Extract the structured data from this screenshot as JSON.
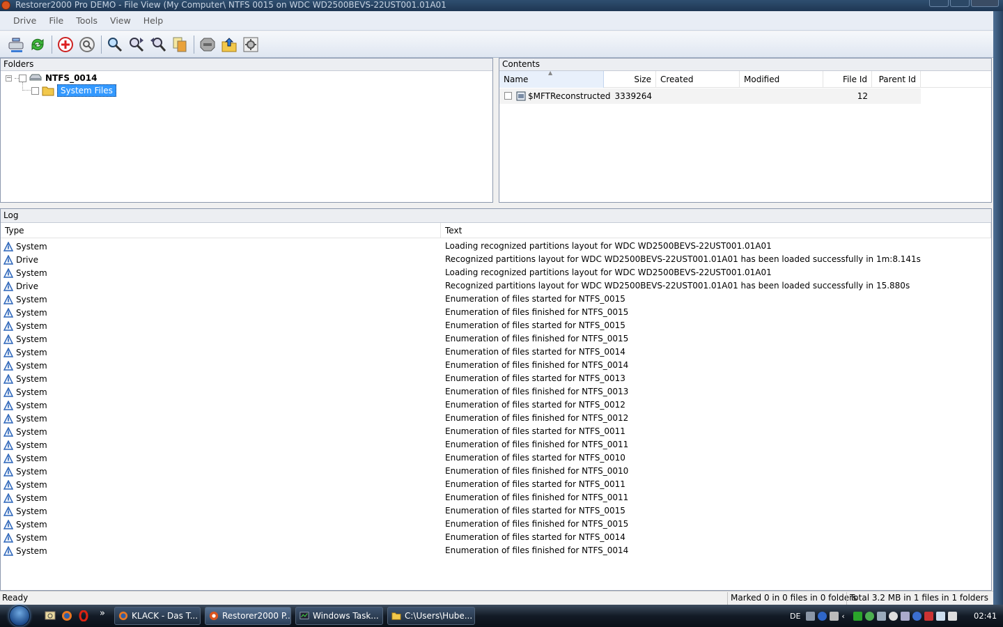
{
  "window": {
    "title": "Restorer2000 Pro DEMO - File View (My Computer\\ NTFS 0015 on WDC WD2500BEVS-22UST001.01A01"
  },
  "menu": [
    "Drive",
    "File",
    "Tools",
    "View",
    "Help"
  ],
  "toolbar": {
    "icons": [
      "connect-drive-icon",
      "refresh-icon",
      "add-region-icon",
      "scan-icon",
      "find-icon",
      "find-next-icon",
      "find-previous-icon",
      "copy-icon",
      "mark-icon",
      "recover-icon",
      "options-icon"
    ]
  },
  "folders": {
    "title": "Folders",
    "root": "NTFS_0014",
    "child": "System Files"
  },
  "contents": {
    "title": "Contents",
    "columns": {
      "name": "Name",
      "size": "Size",
      "created": "Created",
      "modified": "Modified",
      "file_id": "File Id",
      "parent_id": "Parent Id"
    },
    "rows": [
      {
        "name": "$MFTReconstructed",
        "size": "3339264",
        "created": "",
        "modified": "",
        "file_id": "12",
        "parent_id": ""
      }
    ]
  },
  "log": {
    "title": "Log",
    "columns": {
      "type": "Type",
      "text": "Text"
    },
    "rows": [
      {
        "type": "System",
        "text": "Loading recognized partitions layout for WDC WD2500BEVS-22UST001.01A01"
      },
      {
        "type": "Drive",
        "text": "Recognized partitions layout for WDC WD2500BEVS-22UST001.01A01 has been loaded successfully in 1m:8.141s"
      },
      {
        "type": "System",
        "text": "Loading recognized partitions layout for WDC WD2500BEVS-22UST001.01A01"
      },
      {
        "type": "Drive",
        "text": "Recognized partitions layout for WDC WD2500BEVS-22UST001.01A01 has been loaded successfully in 15.880s"
      },
      {
        "type": "System",
        "text": "Enumeration of files started for NTFS_0015"
      },
      {
        "type": "System",
        "text": "Enumeration of files finished for NTFS_0015"
      },
      {
        "type": "System",
        "text": "Enumeration of files started for NTFS_0015"
      },
      {
        "type": "System",
        "text": "Enumeration of files finished for NTFS_0015"
      },
      {
        "type": "System",
        "text": "Enumeration of files started for NTFS_0014"
      },
      {
        "type": "System",
        "text": "Enumeration of files finished for NTFS_0014"
      },
      {
        "type": "System",
        "text": "Enumeration of files started for NTFS_0013"
      },
      {
        "type": "System",
        "text": "Enumeration of files finished for NTFS_0013"
      },
      {
        "type": "System",
        "text": "Enumeration of files started for NTFS_0012"
      },
      {
        "type": "System",
        "text": "Enumeration of files finished for NTFS_0012"
      },
      {
        "type": "System",
        "text": "Enumeration of files started for NTFS_0011"
      },
      {
        "type": "System",
        "text": "Enumeration of files finished for NTFS_0011"
      },
      {
        "type": "System",
        "text": "Enumeration of files started for NTFS_0010"
      },
      {
        "type": "System",
        "text": "Enumeration of files finished for NTFS_0010"
      },
      {
        "type": "System",
        "text": "Enumeration of files started for NTFS_0011"
      },
      {
        "type": "System",
        "text": "Enumeration of files finished for NTFS_0011"
      },
      {
        "type": "System",
        "text": "Enumeration of files started for NTFS_0015"
      },
      {
        "type": "System",
        "text": "Enumeration of files finished for NTFS_0015"
      },
      {
        "type": "System",
        "text": "Enumeration of files started for NTFS_0014"
      },
      {
        "type": "System",
        "text": "Enumeration of files finished for NTFS_0014"
      }
    ]
  },
  "status": {
    "ready": "Ready",
    "marked": "Marked 0 in 0 files in 0 folders",
    "total": "Total 3.2 MB in 1 files in 1 folders"
  },
  "taskbar": {
    "quick_launch": [
      "show-desktop-icon",
      "firefox-icon",
      "opera-icon"
    ],
    "more": "»",
    "tasks": [
      {
        "label": "KLACK - Das T...",
        "icon": "firefox-icon"
      },
      {
        "label": "Restorer2000 P...",
        "icon": "restorer-icon"
      },
      {
        "label": "Windows Task...",
        "icon": "task-manager-icon"
      },
      {
        "label": "C:\\Users\\Hube...",
        "icon": "folder-icon"
      }
    ],
    "language": "DE",
    "clock": "02:41"
  }
}
